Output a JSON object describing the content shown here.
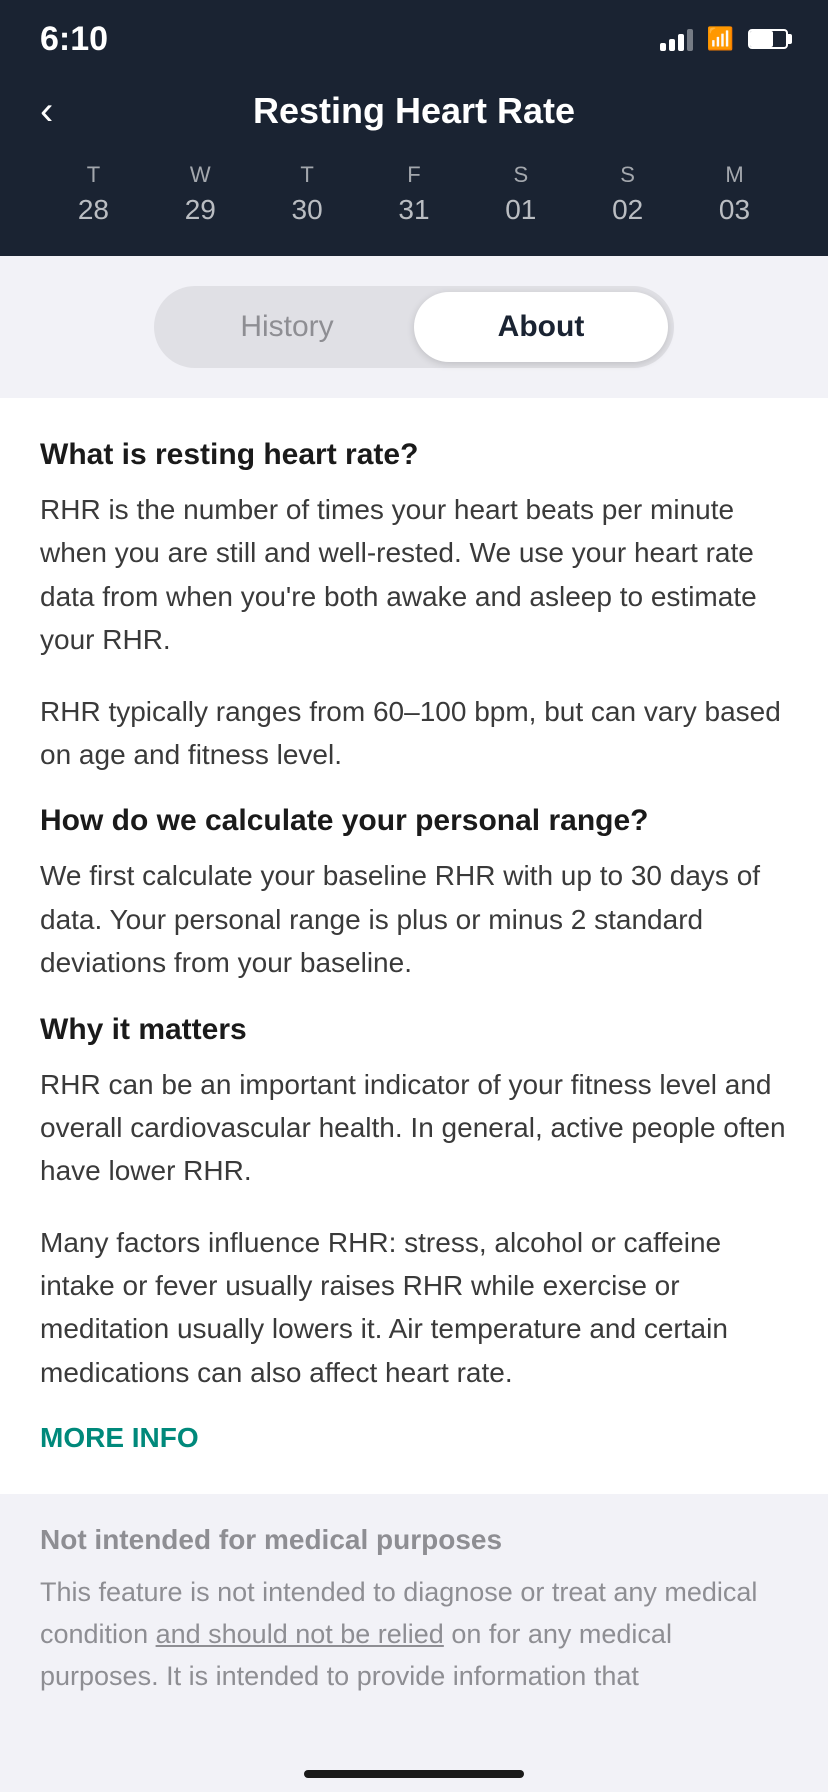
{
  "statusBar": {
    "time": "6:10",
    "signal": [
      true,
      true,
      true,
      false
    ],
    "wifi": true,
    "battery": 65
  },
  "header": {
    "back": "‹",
    "title": "Resting Heart Rate",
    "dates": [
      {
        "dayLetter": "T",
        "dayNumber": "28"
      },
      {
        "dayLetter": "W",
        "dayNumber": "29"
      },
      {
        "dayLetter": "T",
        "dayNumber": "30"
      },
      {
        "dayLetter": "F",
        "dayNumber": "31"
      },
      {
        "dayLetter": "S",
        "dayNumber": "01"
      },
      {
        "dayLetter": "S",
        "dayNumber": "02"
      },
      {
        "dayLetter": "M",
        "dayNumber": "03"
      }
    ]
  },
  "tabs": {
    "history": "History",
    "about": "About",
    "activeTab": "about"
  },
  "about": {
    "section1": {
      "heading": "What is resting heart rate?",
      "para1": "RHR is the number of times your heart beats per minute when you are still and well-rested. We use your heart rate data from when you're both awake and asleep to estimate your RHR.",
      "para2": "RHR typically ranges from 60–100 bpm, but can vary based on age and fitness level."
    },
    "section2": {
      "heading": "How do we calculate your personal range?",
      "para1": "We first calculate your baseline RHR with up to 30 days of data. Your personal range is plus or minus 2 standard deviations from your baseline."
    },
    "section3": {
      "heading": "Why it matters",
      "para1": "RHR can be an important indicator of your fitness level and overall cardiovascular health. In general, active people often have lower RHR.",
      "para2": "Many factors influence RHR: stress, alcohol or caffeine intake or fever usually raises RHR while exercise or meditation usually lowers it. Air temperature and certain medications can also affect heart rate."
    },
    "moreInfo": "MORE INFO",
    "disclaimer": {
      "heading": "Not intended for medical purposes",
      "para1": "This feature is not intended to diagnose or treat any medical condition and should not be relied on for any medical purposes. It is intended to provide information that"
    }
  }
}
